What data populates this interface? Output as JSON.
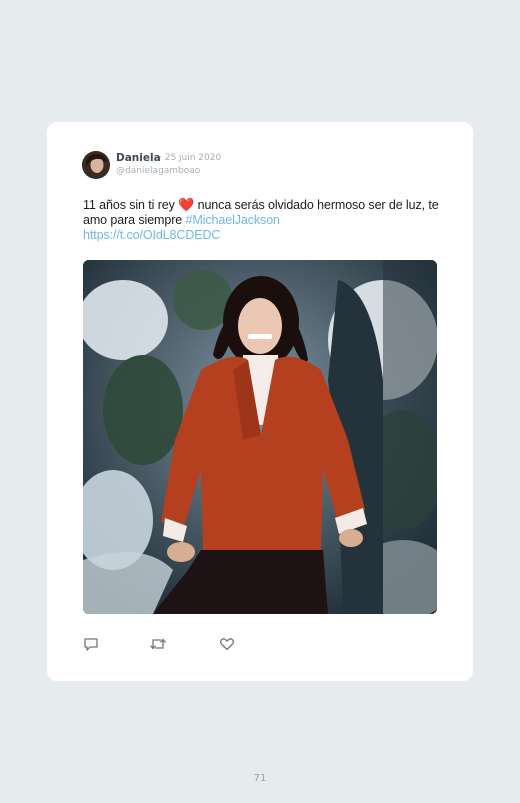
{
  "tweet": {
    "author_name": "Daniela",
    "date": "· 25 juin 2020",
    "handle": "@danielagamboao",
    "text_before_heart": "11 años sin ti rey ",
    "heart": "❤️",
    "text_after_heart": " nunca serás olvidado hermoso ser de luz, te amo para siempre ",
    "hashtag": "#MichaelJackson",
    "link": "https://t.co/OIdL8CDEDC",
    "photo_alt": "Photo of Michael Jackson in a red jacket outdoors"
  },
  "actions": {
    "reply_icon": "reply-icon",
    "retweet_icon": "retweet-icon",
    "like_icon": "like-icon"
  },
  "page": {
    "number": "71"
  },
  "colors": {
    "background": "#e6ebee",
    "card": "#ffffff",
    "link": "#6fb8e6",
    "heart": "#d9102a"
  }
}
